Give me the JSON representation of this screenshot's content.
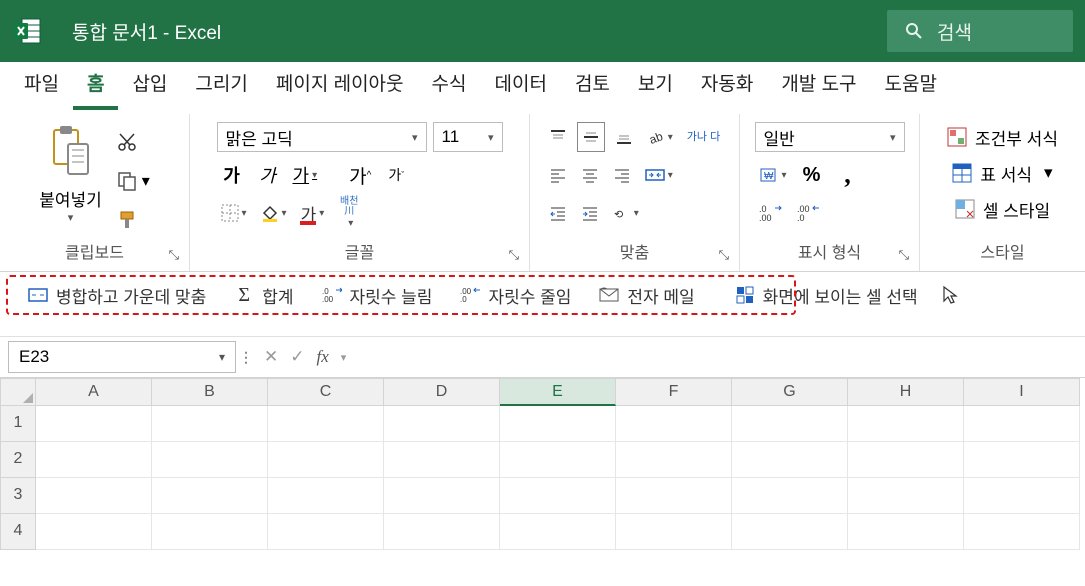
{
  "title": {
    "doc": "통합 문서1",
    "sep": "  -  ",
    "app": "Excel"
  },
  "search": {
    "placeholder": "검색"
  },
  "tabs": {
    "file": "파일",
    "home": "홈",
    "insert": "삽입",
    "draw": "그리기",
    "layout": "페이지 레이아웃",
    "formulas": "수식",
    "data": "데이터",
    "review": "검토",
    "view": "보기",
    "automate": "자동화",
    "developer": "개발 도구",
    "help": "도움말"
  },
  "ribbon": {
    "clipboard": {
      "paste": "붙여넣기",
      "label": "클립보드"
    },
    "font": {
      "name": "맑은 고딕",
      "size": "11",
      "bold": "가",
      "italic": "가",
      "underline": "가",
      "grow": "가",
      "shrink": "가",
      "fontcolor": "가",
      "ruby": "배천",
      "ruby2": "川",
      "label": "글꼴"
    },
    "align": {
      "wrap": "가나\n다",
      "label": "맞춤"
    },
    "number": {
      "format": "일반",
      "percent": "%",
      "comma": ",",
      "label": "표시 형식"
    },
    "styles": {
      "cond": "조건부 서식",
      "table": "표 서식",
      "cell": "셀 스타일",
      "label": "스타일"
    }
  },
  "qat": {
    "merge": "병합하고 가운데 맞춤",
    "sum": "합계",
    "inc": "자릿수 늘림",
    "dec": "자릿수 줄임",
    "email": "전자 메일",
    "visible": "화면에 보이는 셀 선택"
  },
  "fbar": {
    "ref": "E23",
    "fx": "fx"
  },
  "grid": {
    "cols": [
      "A",
      "B",
      "C",
      "D",
      "E",
      "F",
      "G",
      "H",
      "I"
    ],
    "activeCol": "E",
    "rows": [
      "1",
      "2",
      "3",
      "4"
    ]
  }
}
